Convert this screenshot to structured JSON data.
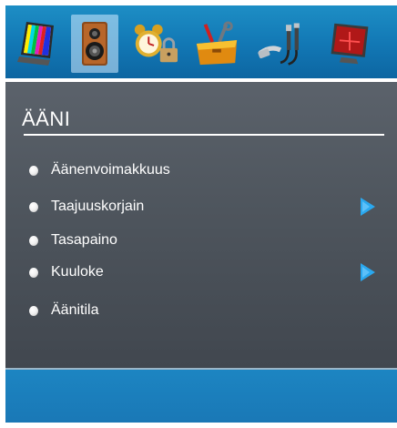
{
  "icons": [
    {
      "name": "picture-icon",
      "selected": false
    },
    {
      "name": "speaker-icon",
      "selected": true
    },
    {
      "name": "alarm-clock-lock-icon",
      "selected": false
    },
    {
      "name": "toolbox-icon",
      "selected": false
    },
    {
      "name": "connection-cables-icon",
      "selected": false
    },
    {
      "name": "monitor-red-cross-icon",
      "selected": false
    }
  ],
  "menu": {
    "title": "ÄÄNI",
    "items": [
      {
        "label": "Äänenvoimakkuus",
        "has_submenu": false
      },
      {
        "label": "Taajuuskorjain",
        "has_submenu": true
      },
      {
        "label": "Tasapaino",
        "has_submenu": false
      },
      {
        "label": "Kuuloke",
        "has_submenu": true
      },
      {
        "label": "Äänitila",
        "has_submenu": false
      }
    ]
  },
  "colors": {
    "header_blue": "#1277b4",
    "menu_gray": "#4e555d",
    "arrow_blue": "#2aa8ef",
    "text_white": "#ffffff"
  }
}
